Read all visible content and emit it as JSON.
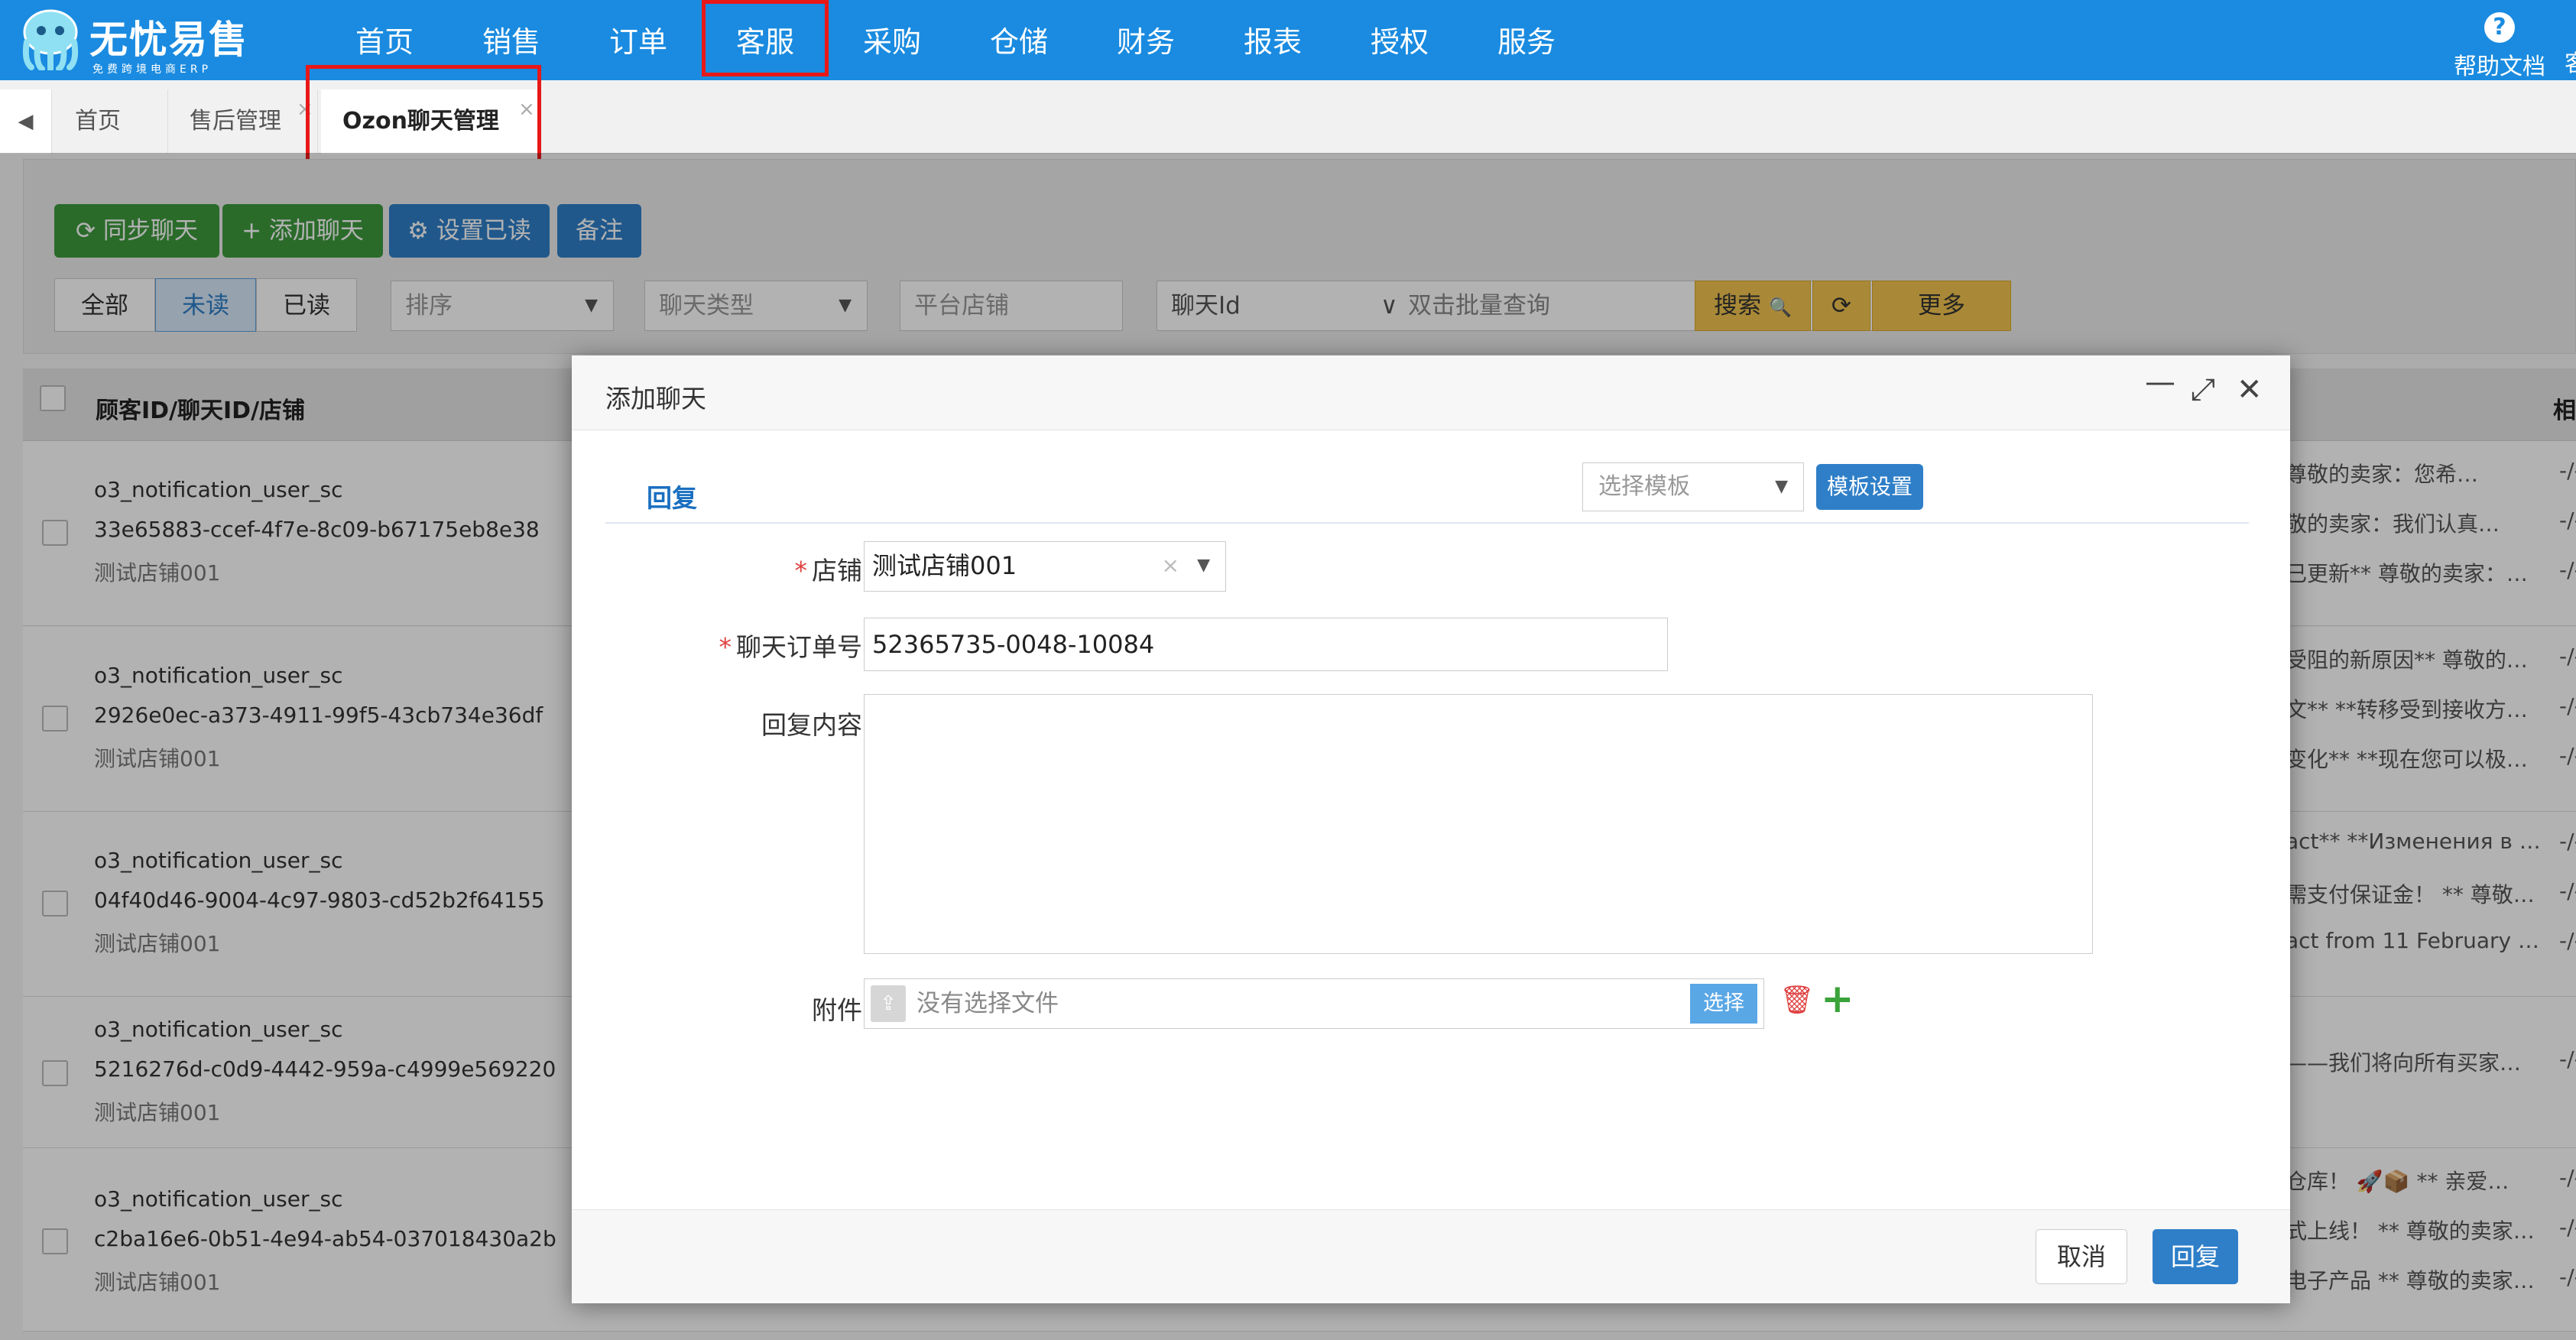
{
  "header": {
    "logo_title": "无忧易售",
    "logo_sub": "免费跨境电商ERP",
    "nav": [
      "首页",
      "销售",
      "订单",
      "客服",
      "采购",
      "仓储",
      "财务",
      "报表",
      "授权",
      "服务"
    ],
    "active_nav": "客服",
    "help_icon": "?",
    "help_label": "帮助文档",
    "help_extra": "客"
  },
  "tabs": {
    "prev_icon": "◀",
    "items": [
      "首页",
      "售后管理",
      "Ozon聊天管理"
    ],
    "close_icon": "×"
  },
  "toolbar": {
    "sync": "同步聊天",
    "add": "添加聊天",
    "mark_read": "设置已读",
    "note": "备注",
    "sync_icon": "⟳",
    "add_icon": "+",
    "mark_icon": "⚙"
  },
  "filters": {
    "all": "全部",
    "unread": "未读",
    "read": "已读",
    "sort": "排序",
    "chat_type": "聊天类型",
    "store_ph": "平台店铺",
    "chat_id": "聊天Id",
    "batch_ph": "双击批量查询",
    "search": "搜索",
    "more": "更多",
    "caret_icon": "▼",
    "chevron_icon": "∨",
    "search_icon": "🔍",
    "refresh_icon": "⟳"
  },
  "table": {
    "header": "顾客ID/聊天ID/店铺",
    "right_header": "相",
    "rows": [
      {
        "user": "o3_notification_user_sc",
        "chat_id": "33e65883-ccef-4f7e-8c09-b67175eb8e38",
        "shop": "测试店铺001",
        "msgs": [
          "尊敬的卖家：您希…",
          "敬的卖家：我们认真…",
          "已更新** 尊敬的卖家：…"
        ]
      },
      {
        "user": "o3_notification_user_sc",
        "chat_id": "2926e0ec-a373-4911-99f5-43cb734e36df",
        "shop": "测试店铺001",
        "msgs": [
          "受阻的新原因** 尊敬的…",
          "文** **转移受到接收方…",
          "变化** **现在您可以极…"
        ]
      },
      {
        "user": "o3_notification_user_sc",
        "chat_id": "04f40d46-9004-4c97-9803-cd52b2f64155",
        "shop": "测试店铺001",
        "msgs": [
          "act** **Изменения в …",
          "需支付保证金！ ** 尊敬…",
          "act from 11 February …"
        ]
      },
      {
        "user": "o3_notification_user_sc",
        "chat_id": "5216276d-c0d9-4442-959a-c4999e569220",
        "shop": "测试店铺001",
        "msgs": [
          "——我们将向所有买家…"
        ]
      },
      {
        "user": "o3_notification_user_sc",
        "chat_id": "c2ba16e6-0b51-4e94-ab54-037018430a2b",
        "shop": "测试店铺001",
        "msgs": [
          "仓库！ 🚀📦 ** 亲爱…",
          "式上线！ ** 尊敬的卖家…",
          "电子产品 ** 尊敬的卖家…"
        ]
      }
    ],
    "dash": "-/-"
  },
  "modal": {
    "title": "添加聊天",
    "minimize_icon": "—",
    "maximize_icon": "⤢",
    "close_icon": "✕",
    "section_tab": "回复",
    "template_ph": "选择模板",
    "template_btn": "模板设置",
    "store_label": "店铺",
    "store_value": "测试店铺001",
    "order_label": "聊天订单号",
    "order_value": "52365735-0048-10084",
    "content_label": "回复内容",
    "attach_label": "附件",
    "file_ph": "没有选择文件",
    "file_btn": "选择",
    "required_mark": "*",
    "clear_icon": "×",
    "upload_icon": "⇪",
    "trash_icon": "🗑",
    "add_icon": "+",
    "cancel": "取消",
    "reply": "回复"
  }
}
